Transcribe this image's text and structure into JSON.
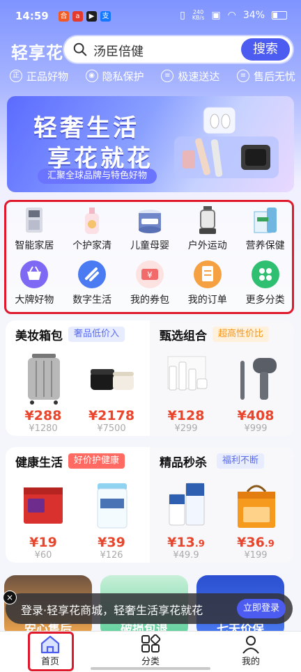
{
  "status": {
    "time": "14:59",
    "speed_top": "240",
    "speed_unit": "KB/s",
    "battery": "34%"
  },
  "header": {
    "logo": "轻享花",
    "search_placeholder": "汤臣倍健",
    "search_button": "搜索"
  },
  "guarantees": [
    {
      "icon": "正",
      "label": "正品好物"
    },
    {
      "icon": "shield-icon",
      "label": "隐私保护"
    },
    {
      "icon": "truck-icon",
      "label": "极速送达"
    },
    {
      "icon": "service-icon",
      "label": "售后无忧"
    }
  ],
  "banner": {
    "line1": "轻奢生活",
    "line2": "享花就花",
    "subtitle": "汇聚全球品牌与特色好物"
  },
  "categories": [
    {
      "label": "智能家居",
      "icon": "smart-home-icon",
      "color": "#9aa7c8"
    },
    {
      "label": "个护家清",
      "icon": "detergent-icon",
      "color": "#f2b8c6"
    },
    {
      "label": "儿童母婴",
      "icon": "formula-icon",
      "color": "#6f86c9"
    },
    {
      "label": "户外运动",
      "icon": "lantern-icon",
      "color": "#7b7b7b"
    },
    {
      "label": "营养保健",
      "icon": "supplement-icon",
      "color": "#6fb7e0"
    },
    {
      "label": "大牌好物",
      "icon": "basket-icon",
      "color": "#7e69f4"
    },
    {
      "label": "数字生活",
      "icon": "digital-icon",
      "color": "#4a7bf2"
    },
    {
      "label": "我的券包",
      "icon": "coupon-icon",
      "color": "#f26b6b"
    },
    {
      "label": "我的订单",
      "icon": "order-icon",
      "color": "#f5a142"
    },
    {
      "label": "更多分类",
      "icon": "more-icon",
      "color": "#2fbf71"
    }
  ],
  "sections": [
    {
      "left": {
        "title": "美妆箱包",
        "tag": "奢品低价入",
        "products": [
          {
            "name": "luggage",
            "price": "¥288",
            "orig": "¥1280"
          },
          {
            "name": "cream",
            "price": "¥2178",
            "orig": "¥7500"
          }
        ]
      },
      "right": {
        "title": "甄选组合",
        "tag": "超高性价比",
        "products": [
          {
            "name": "skincare-set",
            "price": "¥128",
            "orig": "¥299"
          },
          {
            "name": "hair-dryer",
            "price": "¥408",
            "orig": "¥999"
          }
        ]
      }
    },
    {
      "left": {
        "title": "健康生活",
        "tag": "好价护健康",
        "products": [
          {
            "name": "health-box",
            "price": "¥19",
            "orig": "¥60"
          },
          {
            "name": "protein-can",
            "price": "¥39",
            "orig": "¥126"
          }
        ]
      },
      "right": {
        "title": "精品秒杀",
        "tag": "福利不断",
        "products": [
          {
            "name": "milk",
            "price": "¥13",
            "price_dec": ".9",
            "orig": "¥49.9"
          },
          {
            "name": "gift-bag",
            "price": "¥36",
            "price_dec": ".9",
            "orig": "¥199"
          }
        ]
      }
    }
  ],
  "promo_cards": [
    {
      "label": "安心售后",
      "color": "#f5a94e"
    },
    {
      "label": "破损包退",
      "color": "#5ccf9a"
    },
    {
      "label": "七天价保",
      "color": "#4a7bf2"
    }
  ],
  "toast": {
    "text": "登录·轻享花商城，轻奢生活享花就花",
    "button": "立即登录",
    "close": "×"
  },
  "tabbar": {
    "home": "首页",
    "category": "分类",
    "mine": "我的"
  },
  "colors": {
    "accent": "#4d5cf0",
    "price": "#e8452c",
    "highlight": "#e0182b"
  }
}
